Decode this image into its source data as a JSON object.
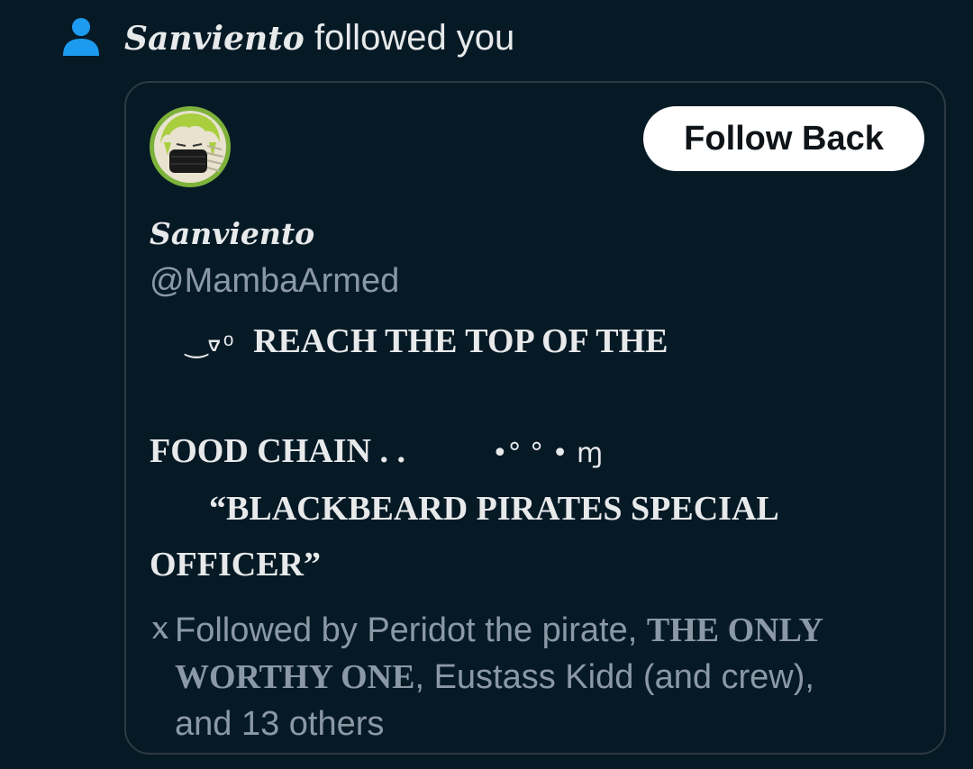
{
  "notification": {
    "follower_name": "Sanviento",
    "action_text": "followed you",
    "icon": "person-icon"
  },
  "card": {
    "avatar": "avatar",
    "follow_back_label": "Follow Back",
    "display_name": "Sanviento",
    "handle": "@MambaArmed",
    "bio": {
      "line1_deco": "‿ᢦ ͦ ",
      "line1_text": "REACH THE TOP OF THE",
      "line2_text": "FOOD CHAIN . .",
      "line2_deco": "•° °  • ɱ",
      "line3_text": "“BLACKBEARD PIRATES SPECIAL",
      "line4_text": "OFFICER”"
    },
    "followed_by": {
      "icon": "x-icon",
      "prefix": "Followed by Peridot the pirate, ",
      "bold_name_part1": "THE ONLY",
      "bold_name_part2": "WORTHY ONE",
      "middle": ", Eustass Kidd (and crew),",
      "suffix": "and 13 others"
    }
  },
  "colors": {
    "background": "#061a26",
    "card_border": "#2c3a44",
    "accent_blue": "#1d9bf0",
    "muted_text": "#8b98a5",
    "primary_text": "#e7e9ea",
    "button_bg": "#ffffff"
  }
}
